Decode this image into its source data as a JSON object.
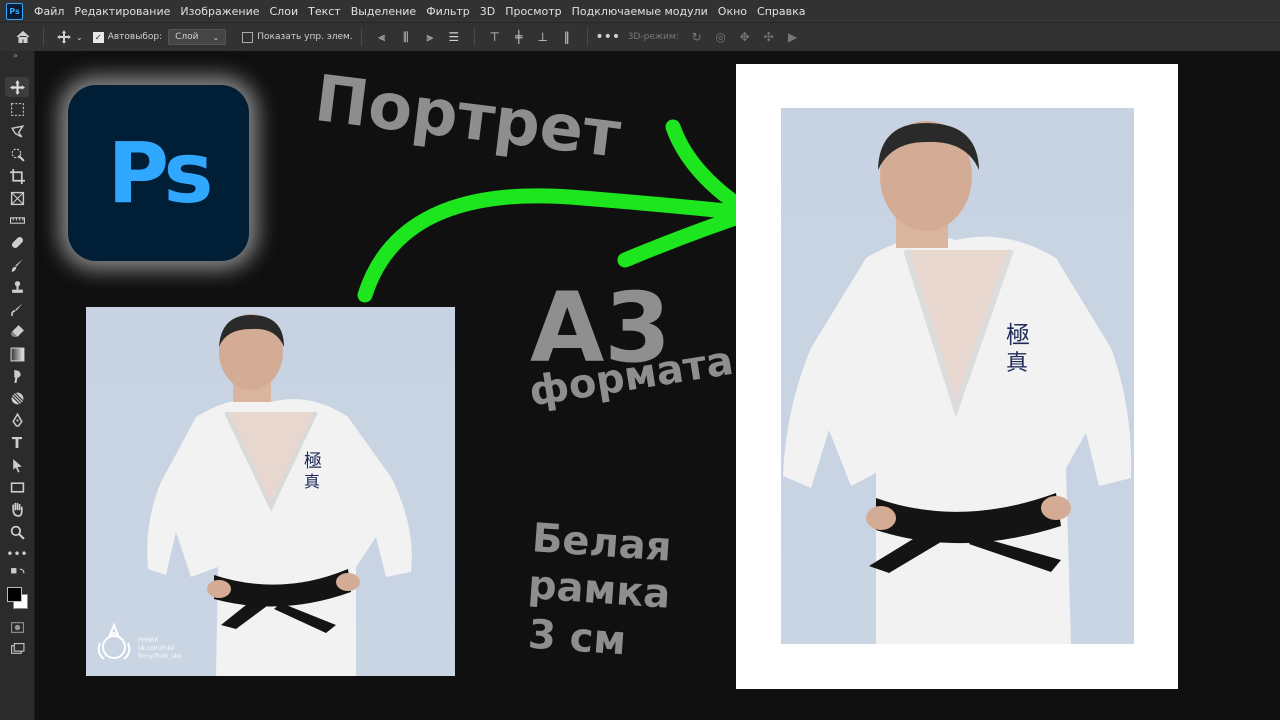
{
  "menu": {
    "app_icon": "Ps",
    "items": [
      "Файл",
      "Редактирование",
      "Изображение",
      "Слои",
      "Текст",
      "Выделение",
      "Фильтр",
      "3D",
      "Просмотр",
      "Подключаемые модули",
      "Окно",
      "Справка"
    ]
  },
  "options": {
    "autoselect_label": "Автовыбор:",
    "autoselect_checked": true,
    "layer_select_value": "Слой",
    "show_controls_label": "Показать упр. элем.",
    "show_controls_checked": false,
    "mode_3d_label": "3D-режим:"
  },
  "thumbnail": {
    "logo_text": "Ps",
    "title": "Портрет",
    "size_big": "А3",
    "size_sub": "формата",
    "frame_line1": "Белая",
    "frame_line2": "рамка",
    "frame_line3": "3 см",
    "watermark_lines": [
      "РНВКК",
      "vk.com/fnkk",
      "firmy/fnkk_sko"
    ]
  },
  "colors": {
    "ps_blue": "#31a8ff",
    "ps_navy": "#001e36",
    "arrow_green": "#1ee61e",
    "frame_white": "#ffffff"
  },
  "icons": {
    "toolbar": [
      "move-tool-icon",
      "marquee-tool-icon",
      "lasso-tool-icon",
      "quick-select-tool-icon",
      "crop-tool-icon",
      "frame-tool-icon",
      "ruler-tool-icon",
      "healing-brush-icon",
      "brush-tool-icon",
      "stamp-tool-icon",
      "history-brush-icon",
      "eraser-tool-icon",
      "gradient-tool-icon",
      "smudge-tool-icon",
      "dodge-tool-icon",
      "pen-tool-icon",
      "type-tool-icon",
      "path-select-tool-icon",
      "rectangle-tool-icon",
      "hand-tool-icon",
      "zoom-tool-icon",
      "more-tools-icon",
      "swap-colors-icon",
      "color-swatches-icon",
      "quick-mask-icon",
      "screen-mode-icon"
    ]
  }
}
